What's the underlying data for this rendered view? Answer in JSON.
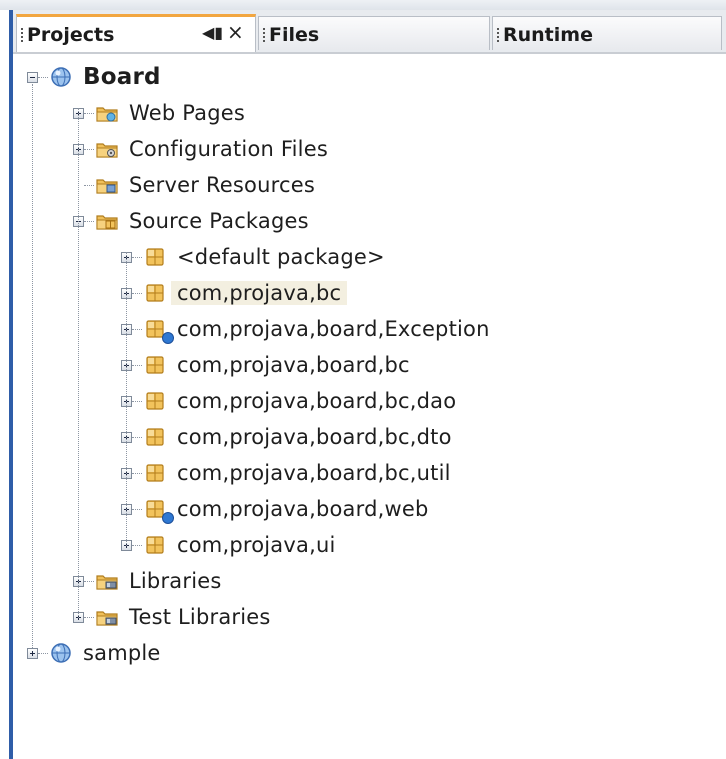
{
  "tabs": [
    {
      "label": "Projects",
      "active": true
    },
    {
      "label": "Files",
      "active": false
    },
    {
      "label": "Runtime",
      "active": false
    }
  ],
  "tab_controls": {
    "pin_glyph": "◀▮",
    "close_glyph": "×"
  },
  "tree": [
    {
      "label": "Board",
      "icon": "project-globe-icon",
      "expander": "minus",
      "bold": true
    },
    {
      "label": "Web Pages",
      "icon": "web-folder-icon",
      "expander": "plus"
    },
    {
      "label": "Configuration Files",
      "icon": "config-folder-icon",
      "expander": "plus"
    },
    {
      "label": "Server Resources",
      "icon": "server-folder-icon",
      "expander": "none"
    },
    {
      "label": "Source Packages",
      "icon": "source-folder-icon",
      "expander": "minus"
    },
    {
      "label": "<default package>",
      "icon": "package-icon",
      "expander": "plus"
    },
    {
      "label": "com,projava,bc",
      "icon": "package-icon",
      "expander": "plus",
      "selected": true
    },
    {
      "label": "com,projava,board,Exception",
      "icon": "package-icon",
      "expander": "plus",
      "badge": true
    },
    {
      "label": "com,projava,board,bc",
      "icon": "package-icon",
      "expander": "plus"
    },
    {
      "label": "com,projava,board,bc,dao",
      "icon": "package-icon",
      "expander": "plus"
    },
    {
      "label": "com,projava,board,bc,dto",
      "icon": "package-icon",
      "expander": "plus"
    },
    {
      "label": "com,projava,board,bc,util",
      "icon": "package-icon",
      "expander": "plus"
    },
    {
      "label": "com,projava,board,web",
      "icon": "package-icon",
      "expander": "plus",
      "badge": true
    },
    {
      "label": "com,projava,ui",
      "icon": "package-icon",
      "expander": "plus"
    },
    {
      "label": "Libraries",
      "icon": "library-folder-icon",
      "expander": "plus"
    },
    {
      "label": "Test Libraries",
      "icon": "library-folder-icon",
      "expander": "plus"
    },
    {
      "label": "sample",
      "icon": "project-globe-icon",
      "expander": "plus"
    }
  ],
  "colors": {
    "accent_tab": "#f2a640",
    "edge": "#2f5da8",
    "selection": "#f3efe0"
  }
}
